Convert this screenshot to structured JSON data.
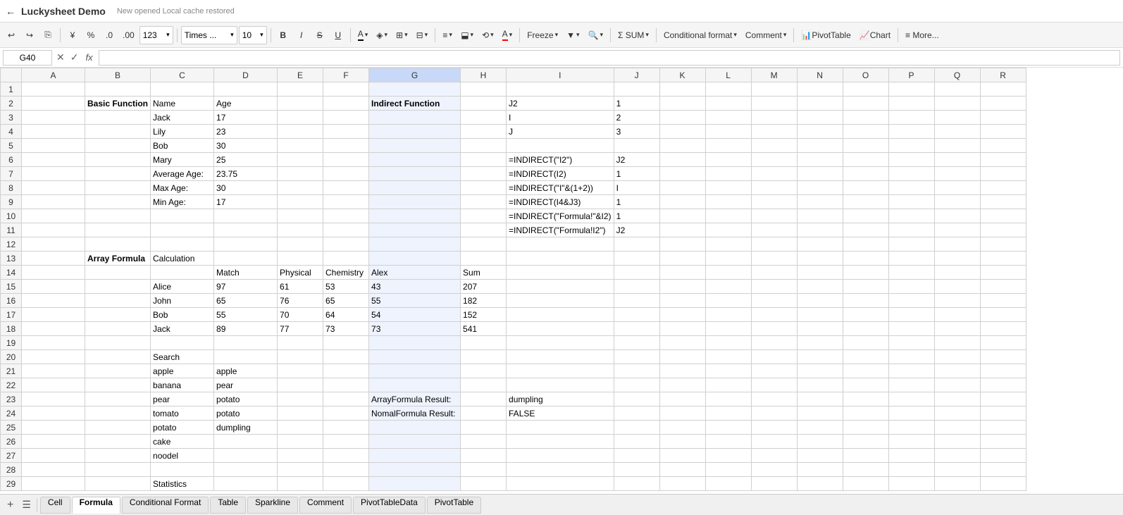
{
  "titlebar": {
    "back_label": "←",
    "app_title": "Luckysheet Demo",
    "new_opened": "New opened",
    "cache_label": "Local cache restored"
  },
  "toolbar": {
    "undo": "↩",
    "redo": "↪",
    "paint": "🖌",
    "currency": "¥",
    "percent": "%",
    "decimal_less": ".0",
    "decimal_more": ".00",
    "format_123": "123",
    "font_name": "Times ...",
    "font_size": "10",
    "bold": "B",
    "italic": "I",
    "strikethrough": "S",
    "underline": "U",
    "font_color": "A",
    "fill_color": "◆",
    "borders": "⊞",
    "merge": "⊟",
    "align_h": "≡",
    "align_v": "⬓",
    "text_rotate": "⟲",
    "text_color2": "A",
    "freeze_label": "Freeze",
    "filter_label": "▼",
    "search_label": "🔍",
    "sum_label": "SUM",
    "cond_format_label": "Conditional format",
    "comment_label": "Comment",
    "pivot_label": "PivotTable",
    "chart_label": "Chart",
    "more_label": "≡ More..."
  },
  "formula_bar": {
    "cell_ref": "G40",
    "fx": "fx",
    "formula_value": ""
  },
  "columns": [
    "",
    "A",
    "B",
    "C",
    "D",
    "E",
    "F",
    "G",
    "H",
    "I",
    "J",
    "K",
    "L",
    "M",
    "N",
    "O",
    "P",
    "Q",
    "R"
  ],
  "rows": {
    "1": {},
    "2": {
      "B": "Basic Function",
      "C": "Name",
      "D": "Age",
      "G": "Indirect Function",
      "I": "J2",
      "J": "1"
    },
    "3": {
      "C": "Jack",
      "D": "17",
      "I": "I",
      "J": "2"
    },
    "4": {
      "C": "Lily",
      "D": "23",
      "I": "J",
      "J": "3"
    },
    "5": {
      "C": "Bob",
      "D": "30"
    },
    "6": {
      "C": "Mary",
      "D": "25",
      "I": "=INDIRECT(\"I2\")",
      "J": "J2"
    },
    "7": {
      "C": "Average Age:",
      "D": "23.75",
      "I": "=INDIRECT(I2)",
      "J": "1"
    },
    "8": {
      "C": "Max Age:",
      "D": "30",
      "I": "=INDIRECT(\"I\"&(1+2))",
      "J": "I"
    },
    "9": {
      "C": "Min Age:",
      "D": "17",
      "I": "=INDIRECT(I4&J3)",
      "J": "1"
    },
    "10": {
      "I": "=INDIRECT(\"Formula!\"&I2)",
      "J": "1"
    },
    "11": {
      "I": "=INDIRECT(\"Formula!I2\")",
      "J": "J2"
    },
    "12": {},
    "13": {
      "B": "Array Formula",
      "C": "Calculation"
    },
    "14": {
      "D": "Match",
      "E": "Physical",
      "F": "Chemistry",
      "G": "Alex",
      "H": "Sum"
    },
    "15": {
      "C": "Alice",
      "D": "97",
      "E": "61",
      "F": "53",
      "G": "43",
      "H": "207"
    },
    "16": {
      "C": "John",
      "D": "65",
      "E": "76",
      "F": "65",
      "G": "55",
      "H": "182"
    },
    "17": {
      "C": "Bob",
      "D": "55",
      "E": "70",
      "F": "64",
      "G": "54",
      "H": "152"
    },
    "18": {
      "C": "Jack",
      "D": "89",
      "E": "77",
      "F": "73",
      "G": "73",
      "H": "541"
    },
    "19": {},
    "20": {
      "C": "Search"
    },
    "21": {
      "C": "apple",
      "D": "apple"
    },
    "22": {
      "C": "banana",
      "D": "pear"
    },
    "23": {
      "C": "pear",
      "D": "potato",
      "G": "ArrayFormula Result:",
      "H": "",
      "I": "dumpling"
    },
    "24": {
      "C": "tomato",
      "D": "potato",
      "G": "NomalFormula Result:",
      "H": "",
      "I": "FALSE"
    },
    "25": {
      "C": "potato",
      "D": "dumpling"
    },
    "26": {
      "C": "cake"
    },
    "27": {
      "C": "noodel"
    },
    "28": {},
    "29": {
      "C": "Statistics"
    }
  },
  "tabs": [
    {
      "label": "Cell",
      "active": false
    },
    {
      "label": "Formula",
      "active": true
    },
    {
      "label": "Conditional Format",
      "active": false
    },
    {
      "label": "Table",
      "active": false
    },
    {
      "label": "Sparkline",
      "active": false
    },
    {
      "label": "Comment",
      "active": false
    },
    {
      "label": "PivotTableData",
      "active": false
    },
    {
      "label": "PivotTable",
      "active": false
    }
  ]
}
